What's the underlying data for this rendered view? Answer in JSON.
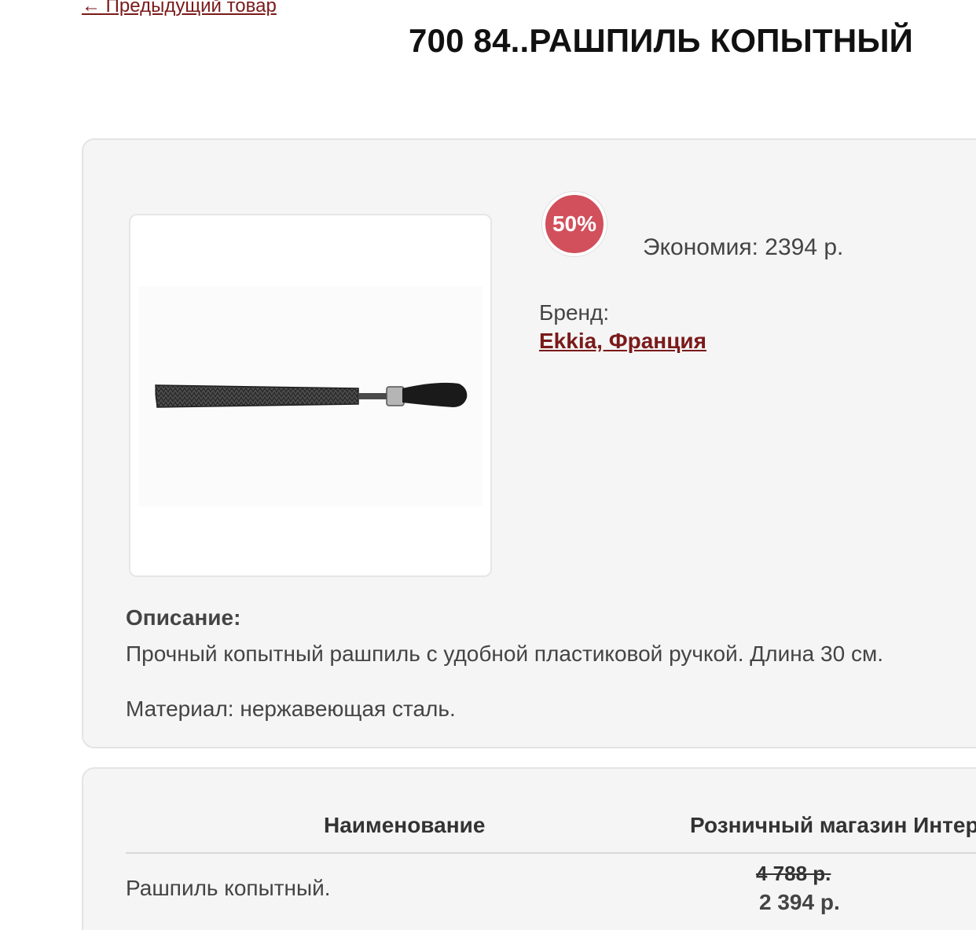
{
  "nav": {
    "prev_link": "← Предыдущий товар"
  },
  "product": {
    "title": "700 84..РАШПИЛЬ КОПЫТНЫЙ",
    "discount_badge": "50%",
    "economy": "Экономия: 2394 р.",
    "brand_label": "Бренд:",
    "brand_value": "Ekkia, Франция",
    "description_heading": "Описание:",
    "description_lines": [
      "Прочный копытный рашпиль с удобной пластиковой ручкой. Длина 30 см.",
      "Материал: нержавеющая сталь."
    ],
    "image_icon": "hoof-rasp-image"
  },
  "table": {
    "headers": [
      "Наименование",
      "Розничный магазин Интер"
    ],
    "rows": [
      {
        "name": "Рашпиль копытный.",
        "retail_old_price": "4 788 р.",
        "retail_new_price": "2 394 р."
      }
    ]
  },
  "colors": {
    "accent_link": "#7a1a1a",
    "badge": "#d1505c",
    "card_bg": "#f5f5f5"
  }
}
